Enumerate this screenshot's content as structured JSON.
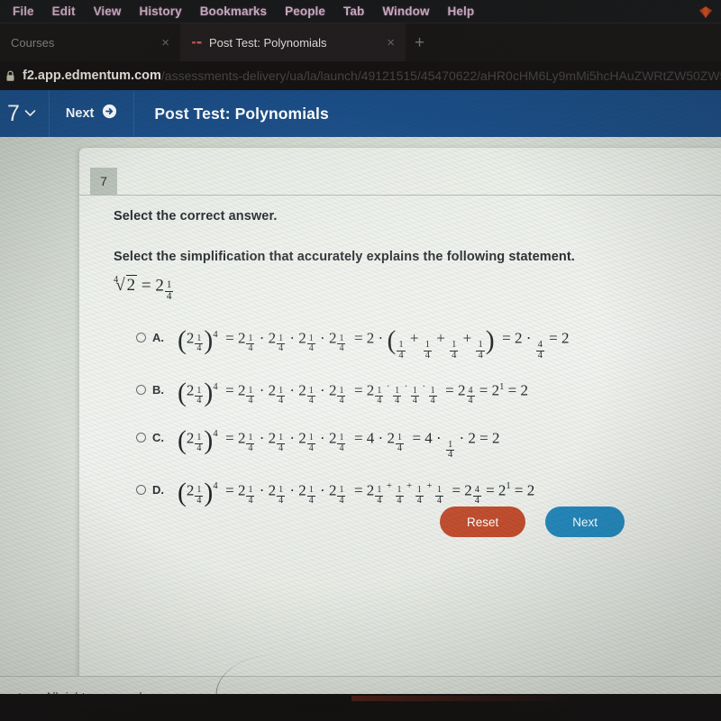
{
  "browser": {
    "menubar": {
      "items": [
        "File",
        "Edit",
        "View",
        "History",
        "Bookmarks",
        "People",
        "Tab",
        "Window",
        "Help"
      ],
      "right_icon": "diamond-app-icon"
    },
    "tabs": [
      {
        "title": "Courses",
        "active": false,
        "close_label": "×"
      },
      {
        "title": "Post Test: Polynomials",
        "active": true,
        "close_label": "×"
      }
    ],
    "new_tab_label": "+",
    "address": {
      "lock_icon": "lock-icon",
      "host": "f2.app.edmentum.com",
      "path": "/assessments-delivery/ua/la/launch/49121515/45470622/aHR0cHM6Ly9mMi5hcHAuZWRtZW50ZW50..."
    }
  },
  "app_header": {
    "question_number": "7",
    "chevron_icon": "chevron-down-icon",
    "next_label": "Next",
    "next_icon": "circle-arrow-right-icon",
    "title": "Post Test: Polynomials",
    "background_color": "#1a4d86"
  },
  "question": {
    "badge_number": "7",
    "prompt": "Select the correct answer.",
    "statement_text": "Select the simplification that accurately explains the following statement.",
    "statement_math": {
      "root_index": "4",
      "radicand": "2",
      "equals": "=",
      "base": "2",
      "exp_num": "1",
      "exp_den": "4"
    },
    "options": [
      {
        "letter": "A.",
        "selected": false,
        "math_description": "(2^(1/4))^4 = 2^(1/4) · 2^(1/4) · 2^(1/4) · 2^(1/4) = 2 · (1/4 + 1/4 + 1/4 + 1/4) = 2 · 4/4 = 2"
      },
      {
        "letter": "B.",
        "selected": false,
        "math_description": "(2^(1/4))^4 = 2^(1/4) · 2^(1/4) · 2^(1/4) · 2^(1/4) = 2^(1/4 · 1/4 · 1/4 · 1/4) = 2^(4/4) = 2^1 = 2"
      },
      {
        "letter": "C.",
        "selected": false,
        "math_description": "(2^(1/4))^4 = 2^(1/4) · 2^(1/4) · 2^(1/4) · 2^(1/4) = 4 · 2^(1/4) = 4 · 1/4 · 2 = 2"
      },
      {
        "letter": "D.",
        "selected": false,
        "math_description": "(2^(1/4))^4 = 2^(1/4) · 2^(1/4) · 2^(1/4) · 2^(1/4) = 2^(1/4 + 1/4 + 1/4 + 1/4) = 2^(4/4) = 2^1 = 2"
      }
    ]
  },
  "actions": {
    "reset_label": "Reset",
    "reset_color": "#bf4828",
    "next_label": "Next",
    "next_color": "#1e85b9"
  },
  "footer": {
    "copyright": "mentum. All rights reserved."
  }
}
